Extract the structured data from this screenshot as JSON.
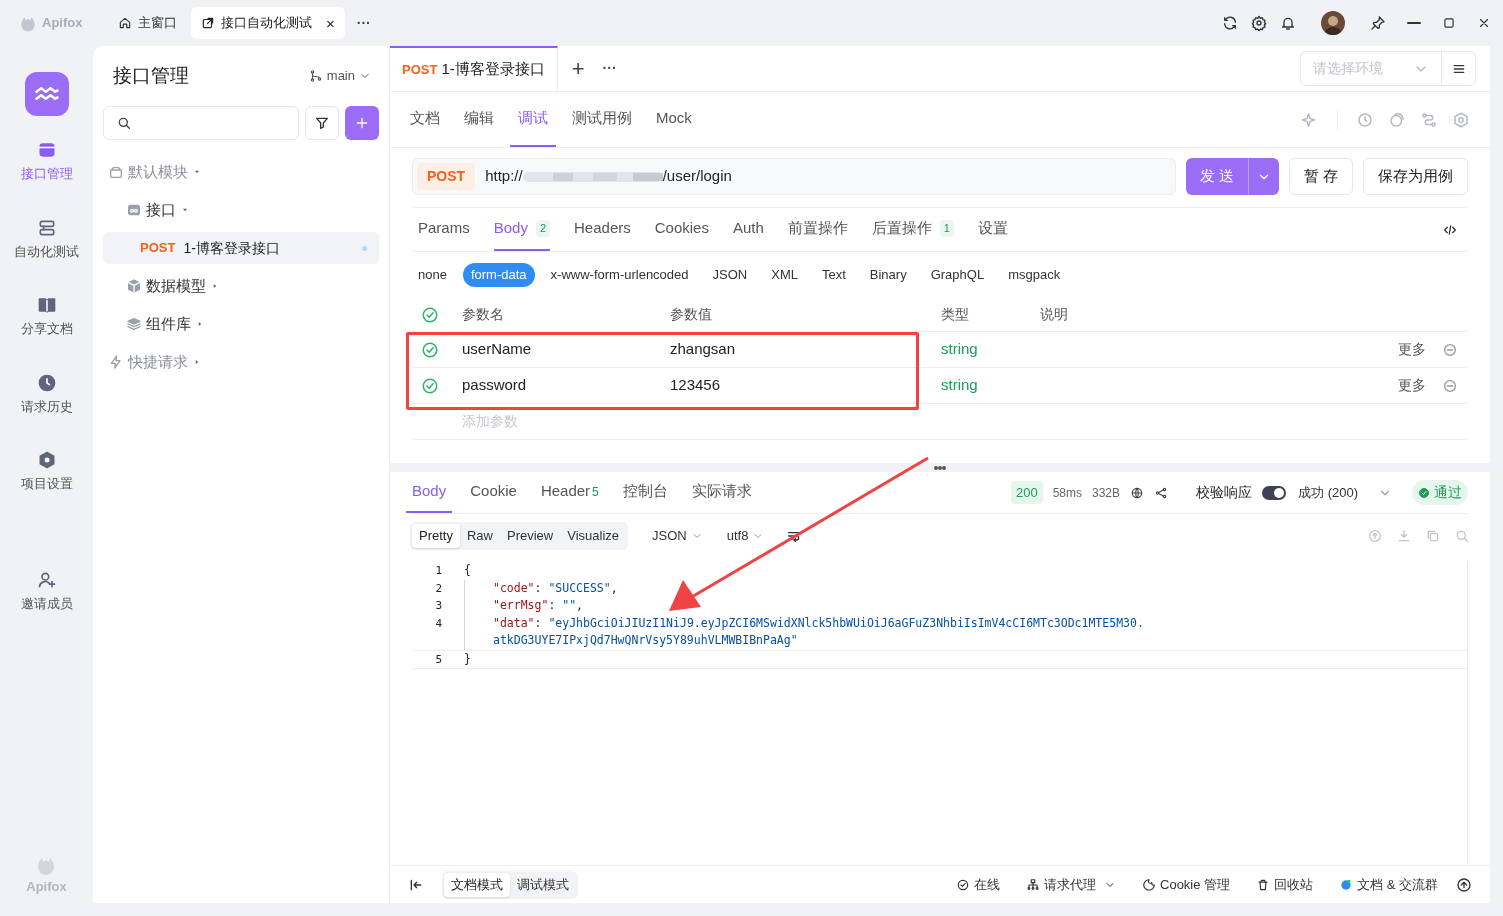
{
  "titlebar": {
    "logo": "Apifox",
    "tabs": [
      {
        "kind": "home",
        "label": "主窗口",
        "selected": false
      },
      {
        "kind": "link",
        "label": "接口自动化测试",
        "selected": true,
        "close": "×"
      }
    ],
    "more": "···"
  },
  "rail": {
    "items": [
      {
        "kind": "api",
        "label": "接口管理",
        "selected": true
      },
      {
        "kind": "auto",
        "label": "自动化测试",
        "selected": false
      },
      {
        "kind": "doc",
        "label": "分享文档",
        "selected": false
      },
      {
        "kind": "history",
        "label": "请求历史",
        "selected": false
      },
      {
        "kind": "settings",
        "label": "项目设置",
        "selected": false
      },
      {
        "kind": "invite",
        "label": "邀请成员",
        "selected": false
      }
    ],
    "footer_logo": "Apifox"
  },
  "tree": {
    "title": "接口管理",
    "branch": "main",
    "items": [
      {
        "kind": "module",
        "label": "默认模块",
        "muted": true,
        "children": [
          {
            "kind": "api",
            "label": "接口",
            "children": [
              {
                "kind": "endpoint",
                "method": "POST",
                "label": "1-博客登录接口",
                "selected": true
              }
            ]
          },
          {
            "kind": "model",
            "label": "数据模型"
          },
          {
            "kind": "components",
            "label": "组件库"
          }
        ]
      },
      {
        "kind": "quick",
        "label": "快捷请求",
        "muted": true
      }
    ]
  },
  "request_tab": {
    "method": "POST",
    "title": "1-博客登录接口",
    "add": "+",
    "more": "···"
  },
  "environment": {
    "placeholder": "请选择环境"
  },
  "sub_tabs": [
    {
      "label": "文档",
      "selected": false
    },
    {
      "label": "编辑",
      "selected": false
    },
    {
      "label": "调试",
      "selected": true
    },
    {
      "label": "测试用例",
      "selected": false
    },
    {
      "label": "Mock",
      "selected": false
    }
  ],
  "url_bar": {
    "method": "POST",
    "prefix": "http://",
    "suffix": "/user/login"
  },
  "buttons": {
    "send": "发 送",
    "save": "暂 存",
    "save_case": "保存为用例"
  },
  "param_tabs": [
    {
      "label": "Params",
      "selected": false
    },
    {
      "label": "Body",
      "count": "2",
      "selected": true
    },
    {
      "label": "Headers",
      "selected": false
    },
    {
      "label": "Cookies",
      "selected": false
    },
    {
      "label": "Auth",
      "selected": false
    },
    {
      "label": "前置操作",
      "selected": false
    },
    {
      "label": "后置操作",
      "count": "1",
      "selected": false
    },
    {
      "label": "设置",
      "selected": false
    }
  ],
  "body_types": [
    {
      "label": "none",
      "selected": false
    },
    {
      "label": "form-data",
      "selected": true
    },
    {
      "label": "x-www-form-urlencoded",
      "selected": false
    },
    {
      "label": "JSON",
      "selected": false
    },
    {
      "label": "XML",
      "selected": false
    },
    {
      "label": "Text",
      "selected": false
    },
    {
      "label": "Binary",
      "selected": false
    },
    {
      "label": "GraphQL",
      "selected": false
    },
    {
      "label": "msgpack",
      "selected": false
    }
  ],
  "params_table": {
    "all_checked": true,
    "columns": [
      "参数名",
      "参数值",
      "类型",
      "说明"
    ],
    "rows": [
      {
        "checked": true,
        "name": "userName",
        "value": "zhangsan",
        "type": "string",
        "more": "更多"
      },
      {
        "checked": true,
        "name": "password",
        "value": "123456",
        "type": "string",
        "more": "更多"
      }
    ],
    "add_placeholder": "添加参数"
  },
  "response": {
    "tabs": [
      {
        "label": "Body",
        "selected": true
      },
      {
        "label": "Cookie",
        "selected": false
      },
      {
        "label": "Header",
        "count": "5",
        "selected": false
      },
      {
        "label": "控制台",
        "selected": false
      },
      {
        "label": "实际请求",
        "selected": false
      }
    ],
    "status": "200",
    "time": "58ms",
    "size": "332B",
    "validate_label": "校验响应",
    "validate_on": true,
    "validate_result": "成功 (200)",
    "verdict": "通过",
    "views": [
      {
        "label": "Pretty",
        "selected": true
      },
      {
        "label": "Raw",
        "selected": false
      },
      {
        "label": "Preview",
        "selected": false
      },
      {
        "label": "Visualize",
        "selected": false
      }
    ],
    "format": "JSON",
    "encoding": "utf8",
    "code": [
      {
        "number": "1",
        "tokens": [
          {
            "kind": "punct",
            "text": "{"
          }
        ]
      },
      {
        "number": "2",
        "tokens": [
          {
            "kind": "key",
            "text": "\"code\""
          },
          {
            "kind": "punct",
            "text": ": "
          },
          {
            "kind": "string",
            "text": "\"SUCCESS\""
          },
          {
            "kind": "punct",
            "text": ","
          }
        ]
      },
      {
        "number": "3",
        "tokens": [
          {
            "kind": "key",
            "text": "\"errMsg\""
          },
          {
            "kind": "punct",
            "text": ": "
          },
          {
            "kind": "string",
            "text": "\"\""
          },
          {
            "kind": "punct",
            "text": ","
          }
        ]
      },
      {
        "number": "4",
        "tokens": [
          {
            "kind": "key",
            "text": "\"data\""
          },
          {
            "kind": "punct",
            "text": ": "
          },
          {
            "kind": "string",
            "text": "\"eyJhbGciOiJIUzI1NiJ9.eyJpZCI6MSwidXNlck5hbWUiOiJ6aGFuZ3NhbiIsImV4cCI6MTc3ODc1MTE5M30."
          }
        ]
      },
      {
        "tokens": [
          {
            "kind": "string",
            "text": "atkDG3UYE7IPxjQd7HwQNrVsy5Y89uhVLMWBIBnPaAg\""
          }
        ]
      },
      {
        "number": "5",
        "tokens": [
          {
            "kind": "punct",
            "text": "}"
          }
        ]
      }
    ]
  },
  "footer": {
    "modes": [
      {
        "label": "文档模式",
        "selected": true
      },
      {
        "label": "调试模式",
        "selected": false
      }
    ],
    "items": [
      {
        "kind": "online",
        "label": "在线"
      },
      {
        "kind": "proxy",
        "label": "请求代理"
      },
      {
        "kind": "cookie",
        "label": "Cookie 管理"
      },
      {
        "kind": "trash",
        "label": "回收站"
      },
      {
        "kind": "community",
        "label": "文档 & 交流群"
      }
    ]
  }
}
